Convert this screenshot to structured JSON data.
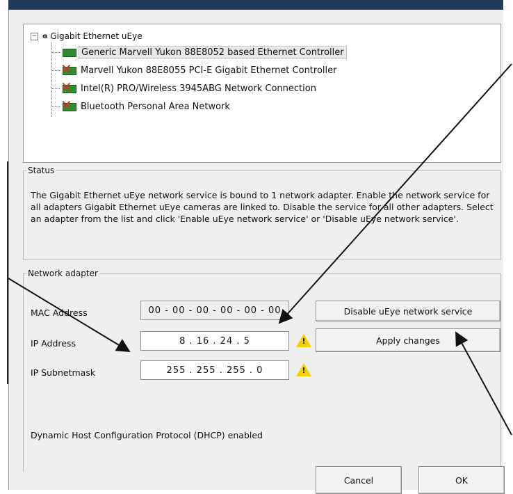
{
  "tree": {
    "root_label": "Gigabit Ethernet uEye",
    "root_icon": "ueye-icon",
    "toggle": "−",
    "items": [
      {
        "label": "Generic Marvell Yukon 88E8052 based Ethernet Controller",
        "icon": "nic-enabled-icon",
        "selected": true
      },
      {
        "label": "Marvell Yukon 88E8055 PCI-E Gigabit Ethernet Controller",
        "icon": "nic-disabled-icon"
      },
      {
        "label": "Intel(R) PRO/Wireless 3945ABG Network Connection",
        "icon": "nic-disabled-icon"
      },
      {
        "label": "Bluetooth Personal Area Network",
        "icon": "nic-disabled-icon"
      }
    ]
  },
  "status": {
    "title": "Status",
    "text": "The Gigabit Ethernet uEye network service is bound to 1 network adapter. Enable the network service for all adapters Gigabit Ethernet uEye cameras are linked to. Disable the service for all other adapters. Select an adapter from the list and click 'Enable uEye network service' or 'Disable uEye network service'."
  },
  "adapter": {
    "title": "Network adapter",
    "mac_label": "MAC Address",
    "mac_value": "00 - 00 - 00 - 00 - 00 - 00",
    "ip_label": "IP Address",
    "ip_value": "8  .  16  .  24  .  5",
    "subnet_label": "IP Subnetmask",
    "subnet_value": "255  .  255  .  255  .  0",
    "warning_icon": "warning-icon",
    "dhcp_text": "Dynamic Host Configuration Protocol (DHCP) enabled"
  },
  "buttons": {
    "disable_service": "Disable uEye network service",
    "apply_changes": "Apply changes",
    "cancel": "Cancel",
    "ok": "OK"
  },
  "colors": {
    "title_bar": "#1f3a5a",
    "dialog_bg": "#efefef",
    "warning": "#f4d200",
    "nic_ok": "#2e8b2e",
    "nic_disabled": "#d03030"
  }
}
